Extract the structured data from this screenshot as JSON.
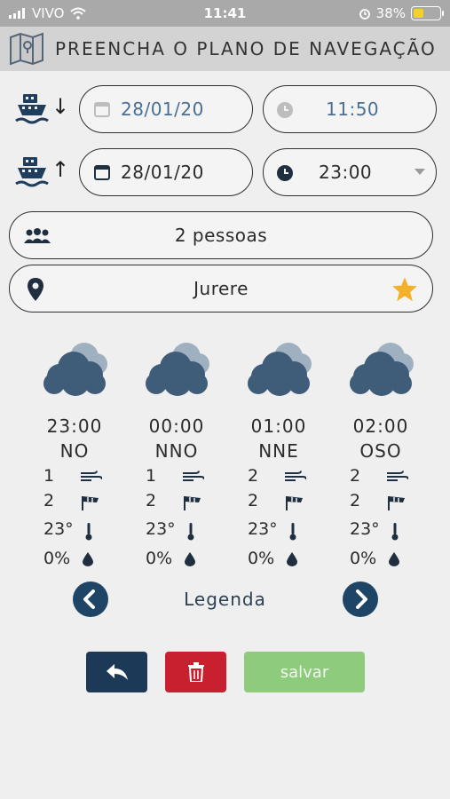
{
  "status": {
    "carrier": "VIVO",
    "time": "11:41",
    "battery": "38%",
    "battery_level": 0.38
  },
  "header": {
    "title": "PREENCHA O PLANO DE NAVEGAÇÃO",
    "icon": "map-icon"
  },
  "departure": {
    "date": "28/01/20",
    "time": "11:50",
    "direction_icon": "arrow-down-icon"
  },
  "return": {
    "date": "28/01/20",
    "time": "23:00",
    "direction_icon": "arrow-up-icon"
  },
  "people": {
    "label": "2 pessoas",
    "icon": "people-icon"
  },
  "location": {
    "label": "Jurere",
    "icon": "location-pin-icon",
    "favorite_icon": "star-icon"
  },
  "forecast": [
    {
      "hour": "23:00",
      "direction": "NO",
      "wind": "1",
      "wave": "2",
      "temp": "23°",
      "rain": "0%"
    },
    {
      "hour": "00:00",
      "direction": "NNO",
      "wind": "1",
      "wave": "2",
      "temp": "23°",
      "rain": "0%"
    },
    {
      "hour": "01:00",
      "direction": "NNE",
      "wind": "2",
      "wave": "2",
      "temp": "23°",
      "rain": "0%"
    },
    {
      "hour": "02:00",
      "direction": "OSO",
      "wind": "2",
      "wave": "2",
      "temp": "23°",
      "rain": "0%"
    }
  ],
  "legend": {
    "label": "Legenda"
  },
  "actions": {
    "save_label": "salvar"
  },
  "colors": {
    "navy": "#1e4566",
    "danger": "#c8202f",
    "save": "#8fcb7d",
    "star": "#f3b12a",
    "cloud": "#3f5c78"
  }
}
